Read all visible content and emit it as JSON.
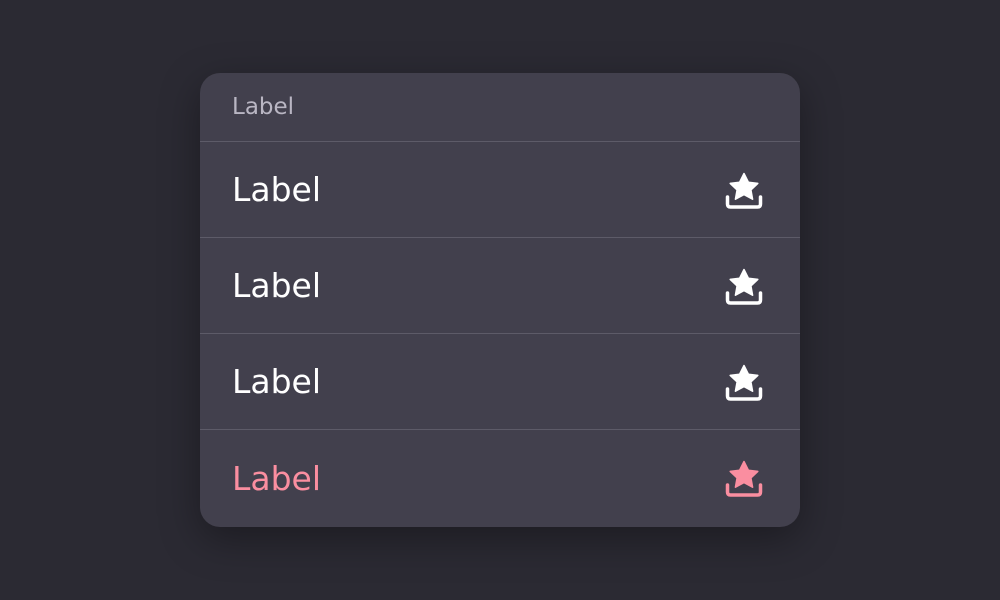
{
  "menu": {
    "header_label": "Label",
    "items": [
      {
        "label": "Label",
        "icon": "star-tray-icon",
        "color": "#ffffff"
      },
      {
        "label": "Label",
        "icon": "star-tray-icon",
        "color": "#ffffff"
      },
      {
        "label": "Label",
        "icon": "star-tray-icon",
        "color": "#ffffff"
      },
      {
        "label": "Label",
        "icon": "star-tray-icon",
        "color": "#fa8ea0",
        "variant": "destructive"
      }
    ]
  },
  "colors": {
    "background": "#2b2a33",
    "surface": "#42404d",
    "divider": "#5d5b68",
    "header_text": "#b9b6c3",
    "item_text": "#ffffff",
    "destructive": "#fa8ea0"
  }
}
